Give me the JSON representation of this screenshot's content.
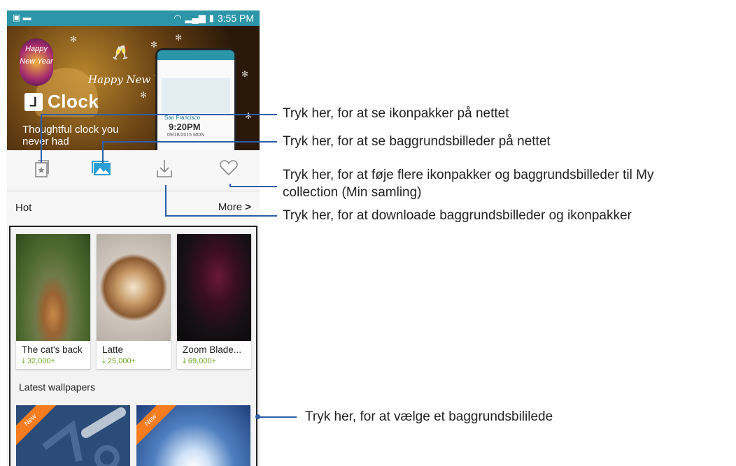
{
  "status_bar": {
    "time": "3:55 PM"
  },
  "banner": {
    "badge_text": "Happy New Year",
    "script_text": "Happy New Year",
    "app_name": "Clock",
    "tagline": "Thoughtful clock you never had",
    "mini_phone": {
      "city": "San Francisco",
      "time": "9:20PM",
      "date": "09/18/2015 MON"
    }
  },
  "tabs": [
    {
      "name": "icon-packs",
      "icon": "book-star-icon"
    },
    {
      "name": "wallpapers",
      "icon": "image-icon",
      "active": true
    },
    {
      "name": "download",
      "icon": "download-icon"
    },
    {
      "name": "collection",
      "icon": "heart-icon"
    }
  ],
  "hot": {
    "label": "Hot",
    "more": "More"
  },
  "hot_cards": [
    {
      "title": "The cat's back",
      "count": "32,000+"
    },
    {
      "title": "Latte",
      "count": "25,000+"
    },
    {
      "title": "Zoom Blade...",
      "count": "69,000+"
    }
  ],
  "latest": {
    "label": "Latest wallpapers",
    "badge": "New"
  },
  "callouts": [
    "Tryk her, for at se ikonpakker på nettet",
    "Tryk her, for at se baggrundsbilleder på nettet",
    "Tryk her, for at føje flere ikonpakker og baggrundsbilleder til My",
    "collection (Min samling)",
    "Tryk her, for at downloade baggrundsbilleder og ikonpakker",
    "Tryk her, for at vælge et baggrundsbililede"
  ],
  "colors": {
    "status_bar": "#2c96a8",
    "accent_blue": "#2b9fd6",
    "download_green": "#6aa81e",
    "callout_line": "#2b5ea8",
    "new_ribbon": "#f57c1f"
  }
}
